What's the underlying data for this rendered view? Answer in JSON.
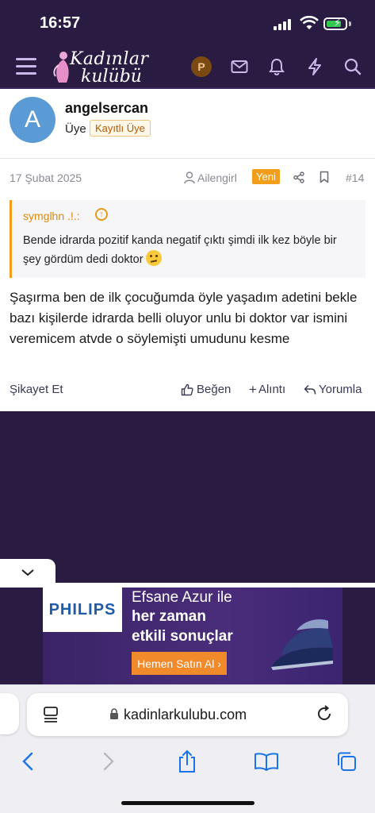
{
  "status": {
    "time": "16:57"
  },
  "site": {
    "logo_line1": "Kadınlar",
    "logo_line2": "kulübü",
    "account_initial": "P"
  },
  "post": {
    "author": "angelsercan",
    "avatar_letter": "A",
    "role": "Üye",
    "badge": "Kayıtlı Üye",
    "date": "17 Şubat 2025",
    "reply_to": "Ailengirl",
    "new_label": "Yeni",
    "number": "#14",
    "quote": {
      "author": "symglhn .!.:",
      "text": "Bende idrarda pozitif kanda negatif çıktı şimdi ilk kez böyle bir şey gördüm dedi doktor"
    },
    "body": "Şaşırma ben de ilk çocuğumda öyle yaşadım adetini bekle bazı kişilerde idrarda belli oluyor unlu bi doktor var ismini veremicem atvde o söylemişti umudunu kesme",
    "actions": {
      "report": "Şikayet Et",
      "like": "Beğen",
      "quote": "Alıntı",
      "reply": "Yorumla"
    }
  },
  "ad": {
    "brand": "PHILIPS",
    "line1": "Efsane Azur ile",
    "line2": "her zaman",
    "line3": "etkili sonuçlar",
    "cta": "Hemen Satın Al ›"
  },
  "browser": {
    "url": "kadinlarkulubu.com"
  },
  "colors": {
    "header_bg": "#2a1b42",
    "accent": "#f29e1a",
    "avatar": "#5b9bd5"
  }
}
